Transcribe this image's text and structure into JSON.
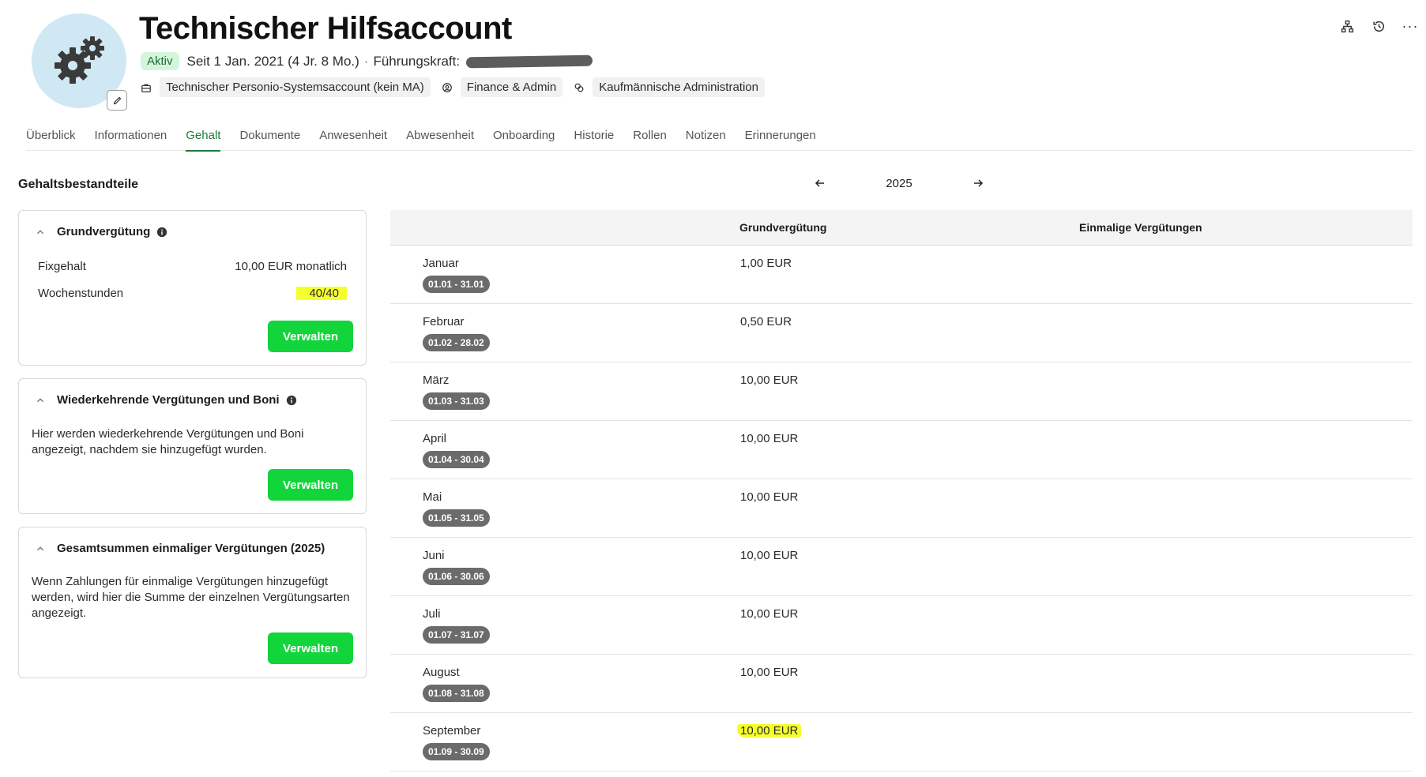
{
  "header": {
    "title": "Technischer Hilfsaccount",
    "status": "Aktiv",
    "since": "Seit 1 Jan. 2021 (4 Jr. 8 Mo.)",
    "separator": "·",
    "manager_label": "Führungskraft:",
    "position": "Technischer Personio-Systemsaccount (kein MA)",
    "department": "Finance & Admin",
    "team": "Kaufmännische Administration",
    "more_label": "···"
  },
  "tabs": [
    "Überblick",
    "Informationen",
    "Gehalt",
    "Dokumente",
    "Anwesenheit",
    "Abwesenheit",
    "Onboarding",
    "Historie",
    "Rollen",
    "Notizen",
    "Erinnerungen"
  ],
  "active_tab": "Gehalt",
  "section": {
    "title": "Gehaltsbestandteile",
    "year": "2025",
    "prev_arrow": "←",
    "next_arrow": "→"
  },
  "cards": {
    "base": {
      "title": "Grundvergütung",
      "salary_label": "Fixgehalt",
      "salary_value": "10,00 EUR monatlich",
      "hours_label": "Wochenstunden",
      "hours_value": "40/40",
      "button": "Verwalten"
    },
    "recurring": {
      "title": "Wiederkehrende Vergütungen und Boni",
      "text": "Hier werden wiederkehrende Vergütungen und Boni angezeigt, nachdem sie hinzugefügt wurden.",
      "button": "Verwalten"
    },
    "onetime": {
      "title": "Gesamtsummen einmaliger Vergütungen (2025)",
      "text": "Wenn Zahlungen für einmalige Vergütungen hinzugefügt werden, wird hier die Summe der einzelnen Vergütungsarten angezeigt.",
      "button": "Verwalten"
    }
  },
  "table": {
    "col_base": "Grundvergütung",
    "col_onetime": "Einmalige Vergütungen",
    "rows": [
      {
        "month": "Januar",
        "range": "01.01 - 31.01",
        "amount": "1,00 EUR"
      },
      {
        "month": "Februar",
        "range": "01.02 - 28.02",
        "amount": "0,50 EUR"
      },
      {
        "month": "März",
        "range": "01.03 - 31.03",
        "amount": "10,00 EUR"
      },
      {
        "month": "April",
        "range": "01.04 - 30.04",
        "amount": "10,00 EUR"
      },
      {
        "month": "Mai",
        "range": "01.05 - 31.05",
        "amount": "10,00 EUR"
      },
      {
        "month": "Juni",
        "range": "01.06 - 30.06",
        "amount": "10,00 EUR"
      },
      {
        "month": "Juli",
        "range": "01.07 - 31.07",
        "amount": "10,00 EUR"
      },
      {
        "month": "August",
        "range": "01.08 - 31.08",
        "amount": "10,00 EUR"
      },
      {
        "month": "September",
        "range": "01.09 - 30.09",
        "amount": "10,00 EUR"
      }
    ]
  },
  "colors": {
    "accent_green": "#12d43b",
    "tab_active": "#1b7d3a",
    "highlight": "#f6ff2e",
    "avatar_bg": "#cfe8f3"
  }
}
